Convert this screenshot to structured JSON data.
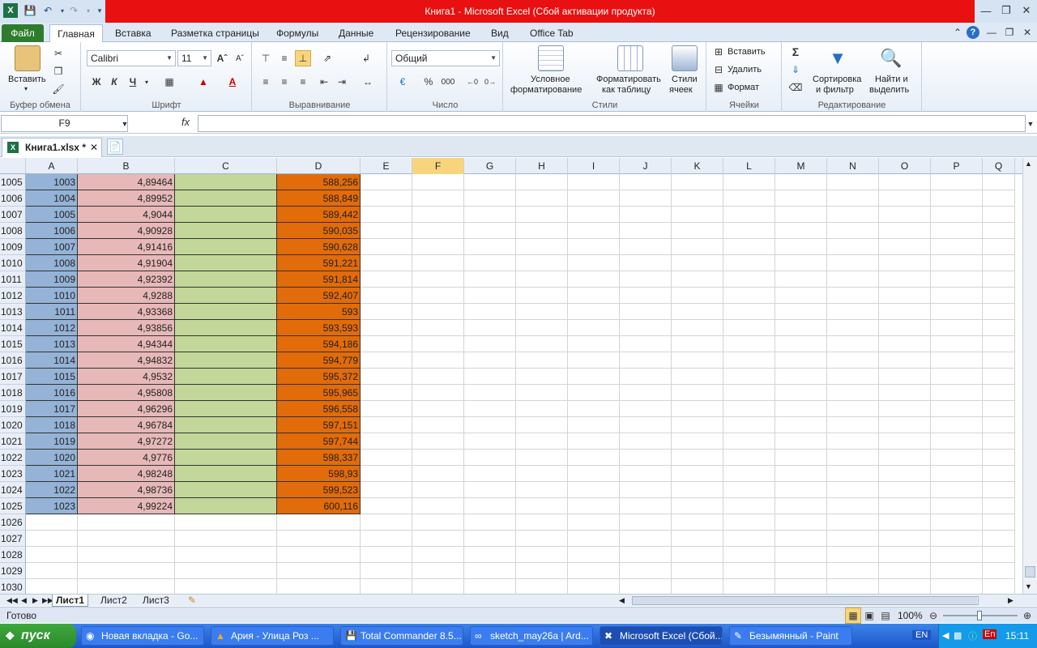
{
  "window": {
    "title": "Книга1  -  Microsoft Excel (Сбой активации продукта)"
  },
  "tabs": [
    "Файл",
    "Главная",
    "Вставка",
    "Разметка страницы",
    "Формулы",
    "Данные",
    "Рецензирование",
    "Вид",
    "Office Tab"
  ],
  "ribbon": {
    "paste_label": "Вставить",
    "clipboard_group": "Буфер обмена",
    "font_name": "Calibri",
    "font_size": "11",
    "bold": "Ж",
    "italic": "К",
    "underline": "Ч",
    "font_group": "Шрифт",
    "align_group": "Выравнивание",
    "number_format": "Общий",
    "percent": "%",
    "thousands": "000",
    "number_group": "Число",
    "cond_format_l1": "Условное",
    "cond_format_l2": "форматирование",
    "format_table_l1": "Форматировать",
    "format_table_l2": "как таблицу",
    "cell_styles_l1": "Стили",
    "cell_styles_l2": "ячеек",
    "styles_group": "Стили",
    "insert": "Вставить",
    "delete": "Удалить",
    "format": "Формат",
    "cells_group": "Ячейки",
    "sort_l1": "Сортировка",
    "sort_l2": "и фильтр",
    "find_l1": "Найти и",
    "find_l2": "выделить",
    "editing_group": "Редактирование"
  },
  "formula_bar": {
    "name_box": "F9",
    "fx": "fx",
    "value": ""
  },
  "document_tab": "Книга1.xlsx *",
  "columns": [
    "A",
    "B",
    "C",
    "D",
    "E",
    "F",
    "G",
    "H",
    "I",
    "J",
    "K",
    "L",
    "M",
    "N",
    "O",
    "P",
    "Q"
  ],
  "selected_column": "F",
  "rows": [
    {
      "n": "1005",
      "a": "1003",
      "b": "4,89464",
      "d": "588,256"
    },
    {
      "n": "1006",
      "a": "1004",
      "b": "4,89952",
      "d": "588,849"
    },
    {
      "n": "1007",
      "a": "1005",
      "b": "4,9044",
      "d": "589,442"
    },
    {
      "n": "1008",
      "a": "1006",
      "b": "4,90928",
      "d": "590,035"
    },
    {
      "n": "1009",
      "a": "1007",
      "b": "4,91416",
      "d": "590,628"
    },
    {
      "n": "1010",
      "a": "1008",
      "b": "4,91904",
      "d": "591,221"
    },
    {
      "n": "1011",
      "a": "1009",
      "b": "4,92392",
      "d": "591,814"
    },
    {
      "n": "1012",
      "a": "1010",
      "b": "4,9288",
      "d": "592,407"
    },
    {
      "n": "1013",
      "a": "1011",
      "b": "4,93368",
      "d": "593"
    },
    {
      "n": "1014",
      "a": "1012",
      "b": "4,93856",
      "d": "593,593"
    },
    {
      "n": "1015",
      "a": "1013",
      "b": "4,94344",
      "d": "594,186"
    },
    {
      "n": "1016",
      "a": "1014",
      "b": "4,94832",
      "d": "594,779"
    },
    {
      "n": "1017",
      "a": "1015",
      "b": "4,9532",
      "d": "595,372"
    },
    {
      "n": "1018",
      "a": "1016",
      "b": "4,95808",
      "d": "595,965"
    },
    {
      "n": "1019",
      "a": "1017",
      "b": "4,96296",
      "d": "596,558"
    },
    {
      "n": "1020",
      "a": "1018",
      "b": "4,96784",
      "d": "597,151"
    },
    {
      "n": "1021",
      "a": "1019",
      "b": "4,97272",
      "d": "597,744"
    },
    {
      "n": "1022",
      "a": "1020",
      "b": "4,9776",
      "d": "598,337"
    },
    {
      "n": "1023",
      "a": "1021",
      "b": "4,98248",
      "d": "598,93"
    },
    {
      "n": "1024",
      "a": "1022",
      "b": "4,98736",
      "d": "599,523"
    },
    {
      "n": "1025",
      "a": "1023",
      "b": "4,99224",
      "d": "600,116"
    },
    {
      "n": "1026",
      "a": "",
      "b": "",
      "d": ""
    },
    {
      "n": "1027",
      "a": "",
      "b": "",
      "d": ""
    },
    {
      "n": "1028",
      "a": "",
      "b": "",
      "d": ""
    },
    {
      "n": "1029",
      "a": "",
      "b": "",
      "d": ""
    },
    {
      "n": "1030",
      "a": "",
      "b": "",
      "d": ""
    }
  ],
  "sheets": [
    "Лист1",
    "Лист2",
    "Лист3"
  ],
  "status": {
    "ready": "Готово",
    "zoom": "100%"
  },
  "taskbar": {
    "start": "пуск",
    "tasks": [
      "Новая вкладка - Go...",
      "Ария - Улица Роз      ...",
      "Total Commander 8.5...",
      "sketch_may26a | Ard...",
      "Microsoft Excel (Сбой...",
      "Безымянный - Paint"
    ],
    "lang": "EN",
    "lang2": "En",
    "clock": "15:11"
  },
  "colors": {
    "colA": "#95b3d7",
    "colB": "#e6b9b8",
    "colC": "#c4d79b",
    "colD": "#e26b0a",
    "title_bar": "#e81010"
  }
}
